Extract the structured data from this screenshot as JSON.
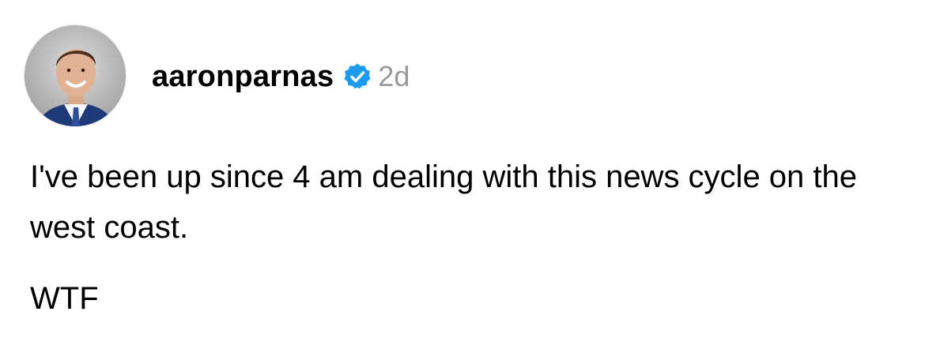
{
  "post": {
    "author": {
      "username": "aaronparnas",
      "verified_icon": "verified-badge-icon",
      "verified_color": "#1d9bf0",
      "avatar_icon": "profile-photo"
    },
    "timestamp": "2d",
    "paragraphs": [
      "I've been up since 4 am dealing with this news cycle on the west coast.",
      "WTF"
    ]
  }
}
